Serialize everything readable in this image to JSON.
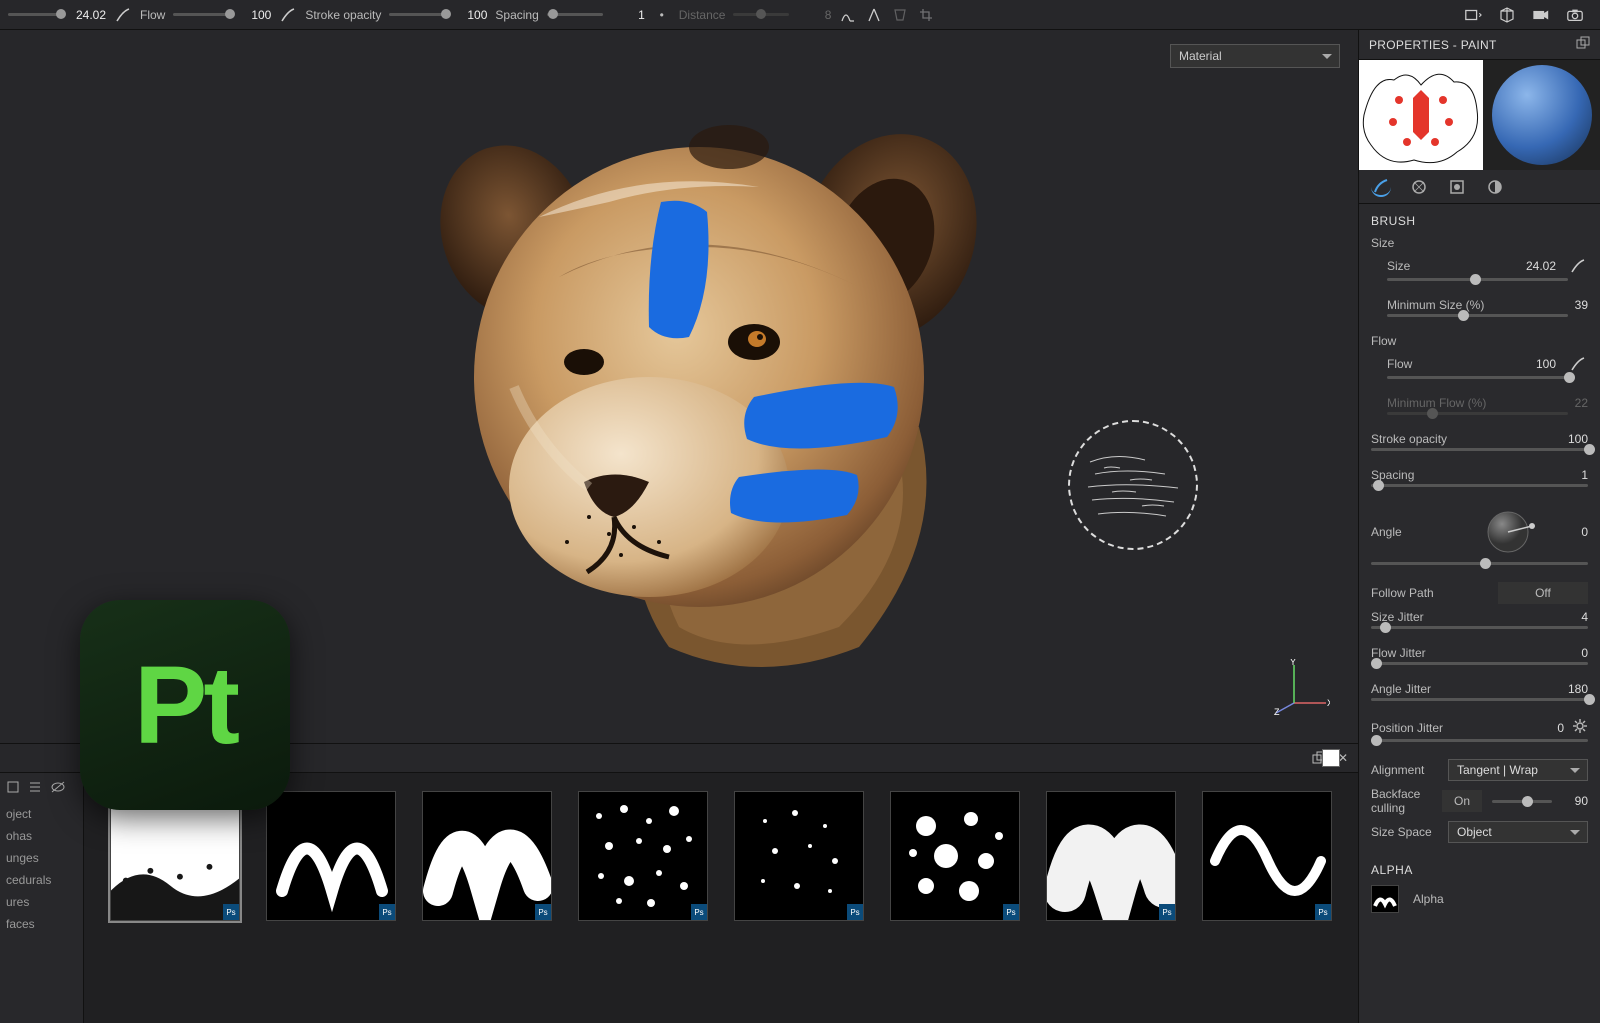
{
  "toolbar": {
    "size": {
      "label": "",
      "value": "24.02",
      "handle": 85
    },
    "flow": {
      "label": "Flow",
      "value": "100",
      "handle": 98
    },
    "stroke_opacity": {
      "label": "Stroke opacity",
      "value": "100",
      "handle": 98
    },
    "spacing": {
      "label": "Spacing",
      "value": "1",
      "handle": 2
    },
    "distance": {
      "label": "Distance",
      "value": "8",
      "handle": 40
    }
  },
  "viewport": {
    "dropdown": "Material",
    "axes": {
      "x": "X",
      "y": "Y",
      "z": "Z"
    }
  },
  "shelf": {
    "icons": [
      "new",
      "list",
      "view",
      "hide"
    ],
    "categories": [
      "oject",
      "ohas",
      "unges",
      "cedurals",
      "ures",
      "faces"
    ],
    "thumbs": [
      {
        "kind": "dust",
        "selected": true
      },
      {
        "kind": "wave"
      },
      {
        "kind": "squiggle_thick"
      },
      {
        "kind": "spatter_dense"
      },
      {
        "kind": "spatter_sparse"
      },
      {
        "kind": "spatter_big"
      },
      {
        "kind": "smear"
      },
      {
        "kind": "sine"
      }
    ]
  },
  "properties": {
    "title": "PROPERTIES - PAINT",
    "tabs": [
      "brush",
      "alpha",
      "stamp",
      "transform"
    ],
    "brush": {
      "heading": "BRUSH",
      "size_label": "Size",
      "size": {
        "label": "Size",
        "value": "24.02",
        "handle": 46
      },
      "min_size": {
        "label": "Minimum Size (%)",
        "value": "39",
        "handle": 39
      },
      "flow_label": "Flow",
      "flow": {
        "label": "Flow",
        "value": "100",
        "handle": 100
      },
      "min_flow": {
        "label": "Minimum Flow (%)",
        "value": "22",
        "handle": 22,
        "disabled": true
      },
      "stroke_opacity": {
        "label": "Stroke opacity",
        "value": "100",
        "handle": 100
      },
      "spacing": {
        "label": "Spacing",
        "value": "1",
        "handle": 1
      },
      "angle": {
        "label": "Angle",
        "value": "0",
        "handle": 50
      },
      "follow_path": {
        "label": "Follow Path",
        "value": "Off"
      },
      "size_jitter": {
        "label": "Size Jitter",
        "value": "4",
        "handle": 4
      },
      "flow_jitter": {
        "label": "Flow Jitter",
        "value": "0",
        "handle": 0
      },
      "angle_jitter": {
        "label": "Angle Jitter",
        "value": "180",
        "handle": 100
      },
      "position_jitter": {
        "label": "Position Jitter",
        "value": "0",
        "handle": 0
      },
      "alignment": {
        "label": "Alignment",
        "value": "Tangent | Wrap"
      },
      "backface": {
        "label": "Backface culling",
        "toggle": "On",
        "value": "90",
        "handle": 50
      },
      "size_space": {
        "label": "Size Space",
        "value": "Object"
      }
    },
    "alpha_heading": "ALPHA",
    "alpha_item": "Alpha"
  },
  "logo": "Pt",
  "colors": {
    "blue_paint": "#1a73e8"
  }
}
